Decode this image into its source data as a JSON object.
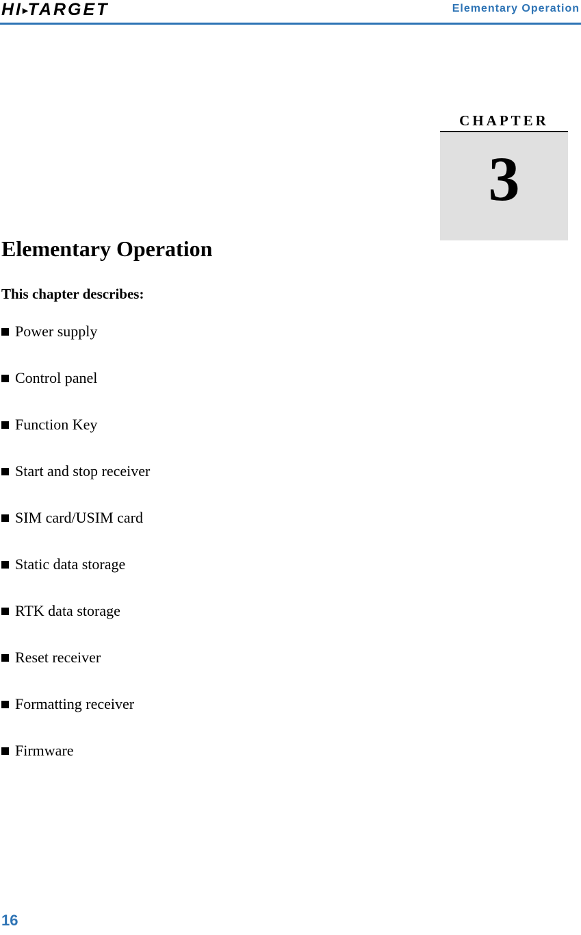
{
  "header": {
    "logo_text": "HI",
    "logo_separator": "▸",
    "logo_text2": "TARGET",
    "running_title": "Elementary  Operation"
  },
  "chapter_badge": {
    "label": "CHAPTER",
    "number": "3"
  },
  "main": {
    "chapter_heading": "Elementary Operation",
    "sub_heading": "This chapter describes:",
    "bullets": [
      "Power supply",
      "Control panel",
      "Function Key",
      "Start and stop receiver",
      "SIM card/USIM card",
      "Static data storage",
      "RTK data storage",
      "Reset receiver",
      "Formatting receiver",
      "Firmware"
    ]
  },
  "footer": {
    "page_number": "16"
  },
  "colors": {
    "accent": "#2e74b5",
    "badge_background": "#e0e0e0"
  }
}
